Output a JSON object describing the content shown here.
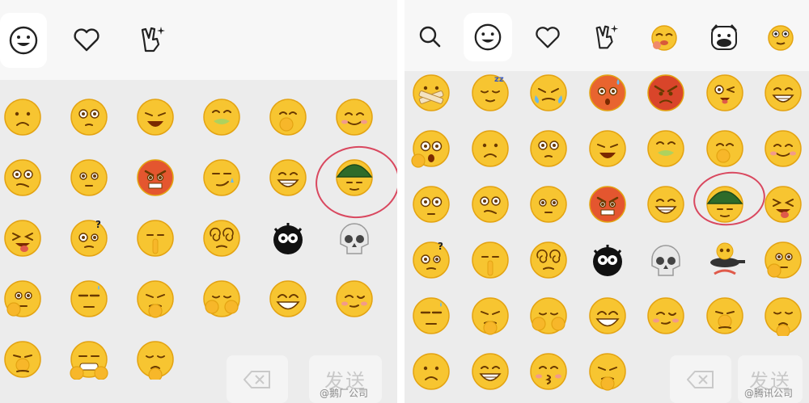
{
  "left_panel": {
    "tabs": [
      "smiley-tab",
      "favorites-tab",
      "gesture-tab"
    ],
    "send_label": "发送",
    "watermark": "@鹅厂公司",
    "emoji_rows": [
      [
        "frown",
        "glance",
        "sob",
        "wince",
        "snicker",
        "smile"
      ],
      [
        "puzzled",
        "blank",
        "angry",
        "smirk",
        "grin",
        "helmet"
      ],
      [
        "tongue-squint",
        "question",
        "shush",
        "dizzy",
        "black-cat",
        "skull"
      ],
      [
        "think",
        "speechless",
        "hmph",
        "peek",
        "laugh",
        "blush"
      ],
      [
        "facepalm",
        "pouty",
        "sigh"
      ]
    ]
  },
  "right_panel": {
    "tabs": [
      "search-tab",
      "smiley-tab",
      "favorites-tab",
      "gesture-tab",
      "pet-tab",
      "cow-tab",
      "goofy-tab"
    ],
    "send_label": "发送",
    "watermark": "@腾讯公司",
    "emoji_rows": [
      [
        "mute",
        "sleepy",
        "cry",
        "scared",
        "rage",
        "wink",
        "grin"
      ],
      [
        "shock",
        "frown",
        "glance",
        "sob",
        "wince",
        "snicker",
        "smile"
      ],
      [
        "stare",
        "puzzled",
        "blank",
        "angry",
        "grin",
        "helmet",
        "tongue-squint"
      ],
      [
        "question",
        "shush",
        "dizzy",
        "black-cat",
        "skull",
        "pan-head",
        "think"
      ],
      [
        "speechless",
        "hmph",
        "peek",
        "laugh",
        "blush",
        "facepalm",
        "sigh"
      ],
      [
        "frown",
        "grin",
        "kiss",
        "hmph"
      ]
    ]
  },
  "colors": {
    "emoji_yellow": "#f7c531",
    "emoji_edge": "#e3a312",
    "helmet_green": "#2e6b2a",
    "annotation_circle": "#d9485f"
  }
}
